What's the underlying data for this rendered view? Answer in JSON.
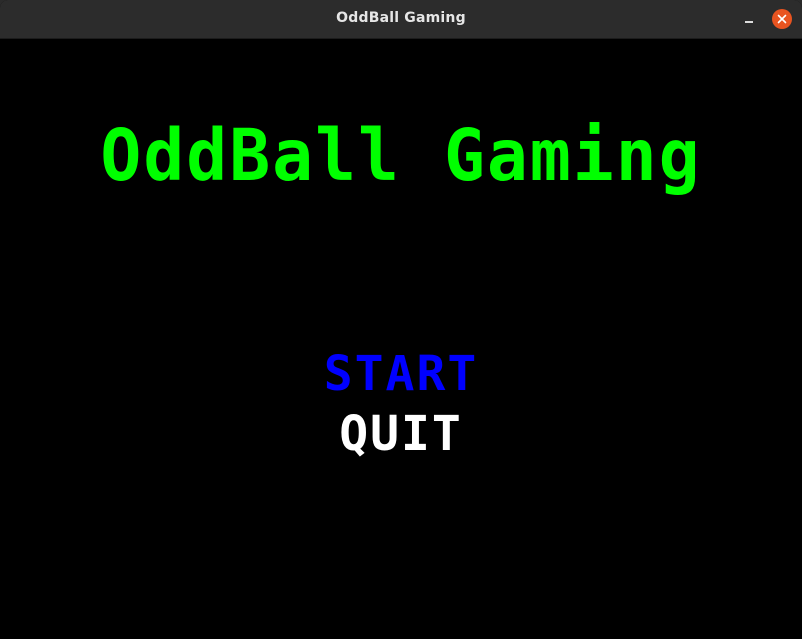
{
  "window": {
    "title": "OddBall Gaming",
    "minimize_icon": "minimize-icon",
    "close_icon": "close-icon",
    "close_color": "#e95420"
  },
  "game": {
    "title": "OddBall Gaming",
    "title_color": "#00ff00",
    "background_color": "#000000",
    "menu": {
      "start_label": "START",
      "start_color": "#0000ff",
      "quit_label": "QUIT",
      "quit_color": "#ffffff",
      "selected": "START"
    }
  }
}
